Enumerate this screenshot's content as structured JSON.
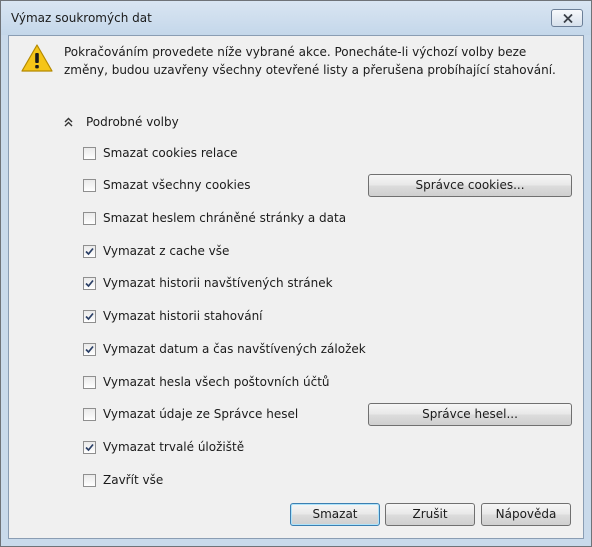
{
  "window": {
    "title": "Výmaz soukromých dat"
  },
  "intro": {
    "text": "Pokračováním provedete níže vybrané akce. Ponecháte-li výchozí volby beze změny, budou uzavřeny všechny otevřené listy a přerušena probíhající stahování."
  },
  "details": {
    "label": "Podrobné volby"
  },
  "options": [
    {
      "label": "Smazat cookies relace",
      "checked": false
    },
    {
      "label": "Smazat všechny cookies",
      "checked": false
    },
    {
      "label": "Smazat heslem chráněné stránky a data",
      "checked": false
    },
    {
      "label": "Vymazat z cache vše",
      "checked": true
    },
    {
      "label": "Vymazat historii navštívených stránek",
      "checked": true
    },
    {
      "label": "Vymazat historii stahování",
      "checked": true
    },
    {
      "label": "Vymazat datum a čas navštívených záložek",
      "checked": true
    },
    {
      "label": "Vymazat hesla všech poštovních účtů",
      "checked": false
    },
    {
      "label": "Vymazat údaje ze Správce hesel",
      "checked": false
    },
    {
      "label": "Vymazat trvalé úložiště",
      "checked": true
    },
    {
      "label": "Zavřít vše",
      "checked": false
    }
  ],
  "buttons": {
    "cookie_manager": "Správce cookies...",
    "password_manager": "Správce hesel...",
    "delete": "Smazat",
    "cancel": "Zrušit",
    "help": "Nápověda"
  },
  "icons": {
    "warning": "warning-icon",
    "close": "close-icon",
    "collapse": "chevron-double-up-icon",
    "check": "checkmark-icon"
  }
}
